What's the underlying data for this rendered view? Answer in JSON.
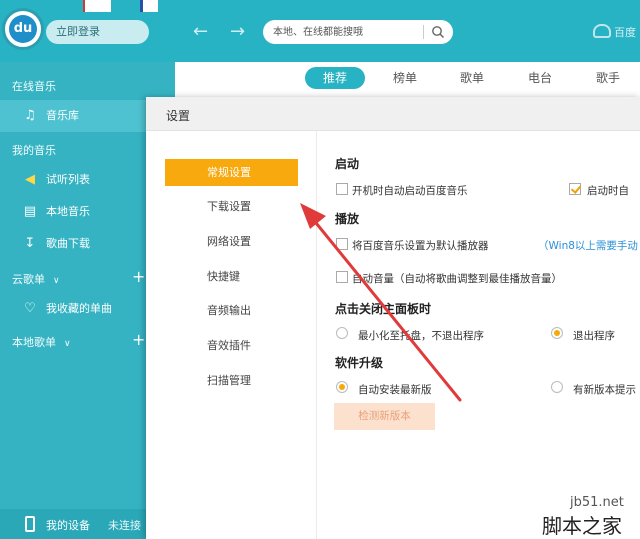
{
  "topbar": {
    "login_label": "立即登录",
    "search_placeholder": "本地、在线都能搜哦",
    "right_text": "百度"
  },
  "sidebar": {
    "sections": [
      "在线音乐",
      "我的音乐",
      "云歌单",
      "本地歌单"
    ],
    "items": [
      {
        "label": "音乐库",
        "icon": "music-note-icon",
        "active": true
      },
      {
        "label": "试听列表",
        "icon": "speaker-icon",
        "active": false
      },
      {
        "label": "本地音乐",
        "icon": "monitor-icon",
        "active": false
      },
      {
        "label": "歌曲下载",
        "icon": "download-icon",
        "active": false
      },
      {
        "label": "我收藏的单曲",
        "icon": "heart-icon",
        "active": false
      }
    ],
    "device_label": "我的设备",
    "device_status": "未连接"
  },
  "content_tabs": [
    {
      "label": "推荐",
      "active": true
    },
    {
      "label": "榜单",
      "active": false
    },
    {
      "label": "歌单",
      "active": false
    },
    {
      "label": "电台",
      "active": false
    },
    {
      "label": "歌手",
      "active": false
    }
  ],
  "dialog": {
    "title": "设置",
    "nav": [
      {
        "label": "常规设置",
        "active": true
      },
      {
        "label": "下载设置",
        "active": false
      },
      {
        "label": "网络设置",
        "active": false
      },
      {
        "label": "快捷键",
        "active": false
      },
      {
        "label": "音频输出",
        "active": false
      },
      {
        "label": "音效插件",
        "active": false
      },
      {
        "label": "扫描管理",
        "active": false
      }
    ],
    "startup": {
      "title": "启动",
      "opt1": "开机时自动启动百度音乐",
      "opt1_checked": false,
      "opt2": "启动时自",
      "opt2_checked": true
    },
    "playback": {
      "title": "播放",
      "opt1": "将百度音乐设置为默认播放器",
      "opt1_hint": "（Win8以上需要手动",
      "opt2": "自动音量（自动将歌曲调整到最佳播放音量）"
    },
    "close_panel": {
      "title": "点击关闭主面板时",
      "opt1": "最小化至托盘，不退出程序",
      "opt1_selected": false,
      "opt2": "退出程序",
      "opt2_selected": true
    },
    "upgrade": {
      "title": "软件升级",
      "opt1": "自动安装最新版",
      "opt1_selected": true,
      "opt2": "有新版本提示",
      "opt2_selected": false,
      "check_button": "检测新版本"
    }
  },
  "watermark": {
    "site": "jb51.net",
    "name": "脚本之家"
  },
  "colors": {
    "accent": "#27b3c3",
    "active_nav": "#f7a90e",
    "arrow": "#e03a3a"
  }
}
